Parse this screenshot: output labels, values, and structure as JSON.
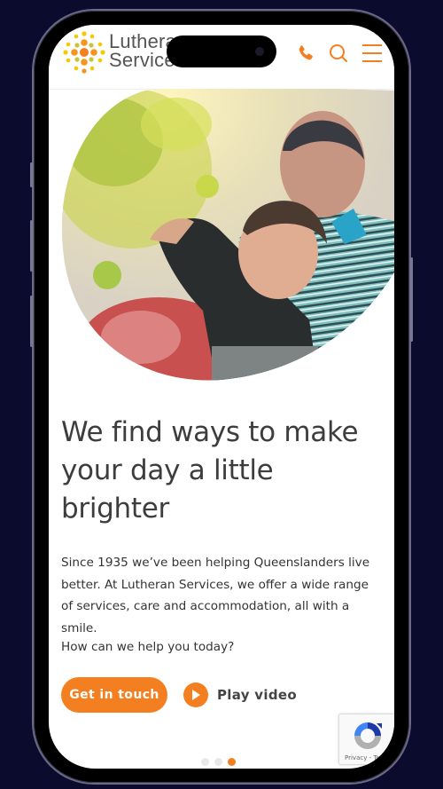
{
  "brand": {
    "name_line1": "Lutheran",
    "name_line2": "Services",
    "accent_color": "#f47f20",
    "secondary_color": "#f5c800"
  },
  "header": {
    "icons": [
      "phone-icon",
      "search-icon",
      "menu-icon"
    ]
  },
  "hero": {
    "image_alt": "Boy and grandfather picking fruit from a tree",
    "headline": "We find ways to make your day a little brighter",
    "body": "Since 1935 we’ve been helping Queenslanders live better. At Lutheran Services, we offer a wide range of services, care and accommodation, all with a smile.",
    "question": "How can we help you today?",
    "cta_label": "Get in touch",
    "play_label": "Play video"
  },
  "carousel": {
    "count": 3,
    "active_index": 2
  },
  "recaptcha": {
    "label": "Privacy - Terms"
  }
}
